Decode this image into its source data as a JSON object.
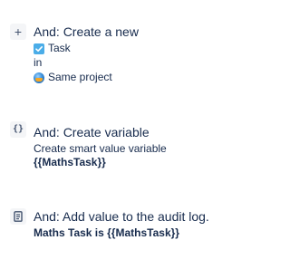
{
  "steps": [
    {
      "icon": "plus-icon",
      "icon_glyph": "+",
      "title": "And: Create a new",
      "issue_type": "Task",
      "in_label": "in",
      "project": "Same project"
    },
    {
      "icon": "curly-braces-icon",
      "icon_glyph": "{}",
      "title": "And: Create variable",
      "description": "Create smart value variable",
      "variable": "{{MathsTask}}"
    },
    {
      "icon": "audit-log-icon",
      "title": "And: Add value to the audit log.",
      "message": "Maths Task is {{MathsTask}}"
    }
  ],
  "colors": {
    "text": "#172b4d",
    "icon_bg": "#f4f5f7",
    "task_blue": "#4bade8"
  }
}
